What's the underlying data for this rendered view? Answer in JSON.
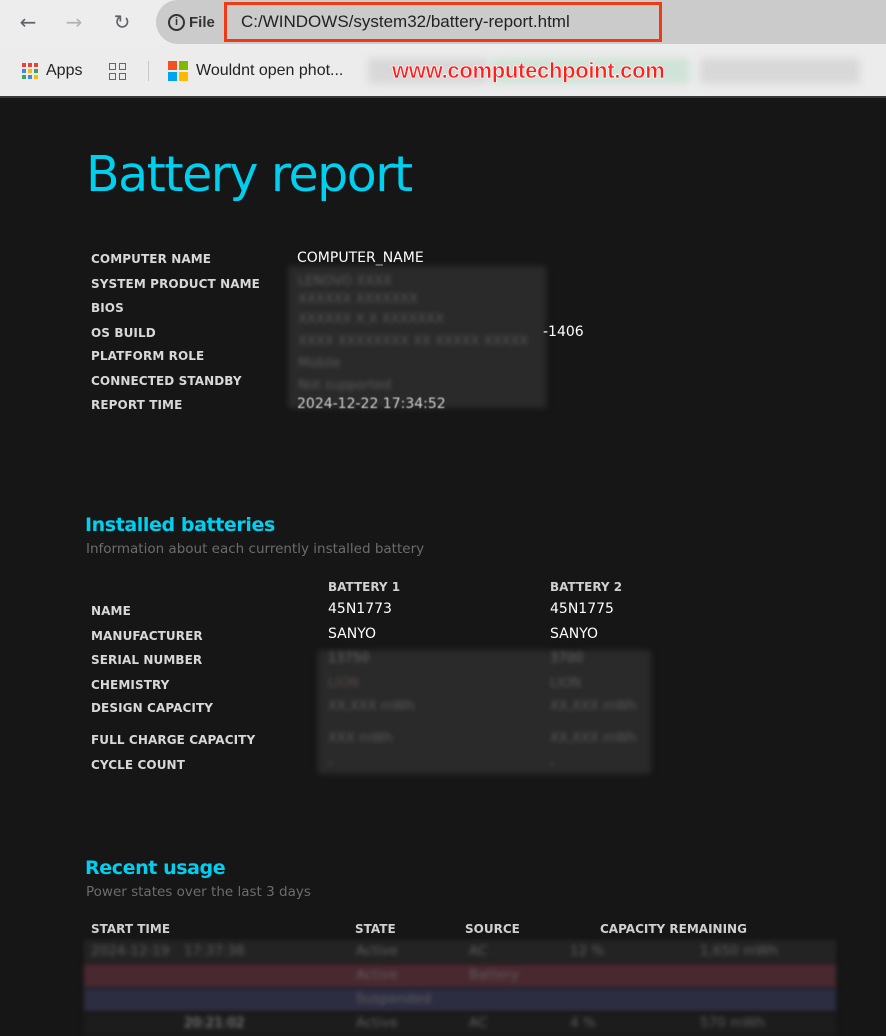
{
  "browser": {
    "nav": {
      "back_icon": "arrow-left-icon",
      "forward_icon": "arrow-right-icon",
      "reload_icon": "reload-icon"
    },
    "site_info": {
      "icon": "info-icon",
      "label": "File"
    },
    "url": "C:/WINDOWS/system32/battery-report.html",
    "highlight_color": "#f03a17",
    "bookmarks": [
      {
        "label": "Apps",
        "icon": "apps-grid-icon"
      },
      {
        "label": "",
        "icon": "tab-grid-icon"
      },
      {
        "label": "Wouldnt open phot...",
        "icon": "microsoft-logo-icon"
      }
    ],
    "watermark": "www.computechpoint.com"
  },
  "report": {
    "title": "Battery report",
    "accent_color": "#00d0f0",
    "system_info": [
      {
        "label": "COMPUTER NAME",
        "value": "COMPUTER_NAME"
      },
      {
        "label": "SYSTEM PRODUCT NAME",
        "value": ""
      },
      {
        "label": "BIOS",
        "value": ""
      },
      {
        "label": "OS BUILD",
        "value": "-1406"
      },
      {
        "label": "PLATFORM ROLE",
        "value": ""
      },
      {
        "label": "CONNECTED STANDBY",
        "value": ""
      },
      {
        "label": "REPORT TIME",
        "value": "2024-12-22  17:34:52"
      }
    ],
    "installed_batteries": {
      "title": "Installed batteries",
      "subtitle": "Information about each currently installed battery",
      "columns": [
        "BATTERY 1",
        "BATTERY 2"
      ],
      "rows": [
        {
          "label": "NAME",
          "values": [
            "45N1773",
            "45N1775"
          ]
        },
        {
          "label": "MANUFACTURER",
          "values": [
            "SANYO",
            "SANYO"
          ]
        },
        {
          "label": "SERIAL NUMBER",
          "values": [
            "13750",
            "3700"
          ]
        },
        {
          "label": "CHEMISTRY",
          "values": [
            "LION",
            "LION"
          ]
        },
        {
          "label": "DESIGN CAPACITY",
          "values": [
            "",
            ""
          ]
        },
        {
          "label": "FULL CHARGE CAPACITY",
          "values": [
            "",
            ""
          ]
        },
        {
          "label": "CYCLE COUNT",
          "values": [
            "-",
            "-"
          ]
        }
      ]
    },
    "recent_usage": {
      "title": "Recent usage",
      "subtitle": "Power states over the last 3 days",
      "columns": [
        "START TIME",
        "STATE",
        "SOURCE",
        "CAPACITY REMAINING"
      ],
      "rows": [
        {
          "date": "2024-12-19",
          "time": "17:37:38",
          "state": "Active",
          "source": "AC",
          "percent": "12 %",
          "capacity": "1,650 mWh",
          "bg": "#232323"
        },
        {
          "date": "",
          "time": "",
          "state": "Active",
          "source": "Battery",
          "percent": "",
          "capacity": "",
          "bg": "#4a2830"
        },
        {
          "date": "",
          "time": "",
          "state": "Suspended",
          "source": "",
          "percent": "",
          "capacity": "",
          "bg": "#2d2d42"
        },
        {
          "date": "",
          "time": "20:21:02",
          "state": "Active",
          "source": "AC",
          "percent": "4 %",
          "capacity": "570 mWh",
          "bg": "#1c1c1c"
        }
      ]
    }
  }
}
